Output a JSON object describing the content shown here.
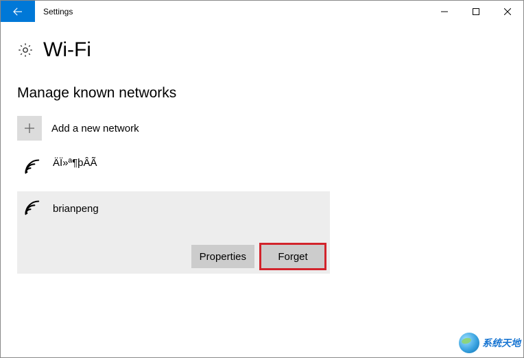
{
  "window": {
    "title": "Settings"
  },
  "page": {
    "title": "Wi-Fi",
    "section_heading": "Manage known networks"
  },
  "add": {
    "label": "Add a new network"
  },
  "networks": [
    {
      "name": "ÄÏ»ª¶þÂÃ",
      "selected": false
    },
    {
      "name": "brianpeng",
      "selected": true
    }
  ],
  "actions": {
    "properties": "Properties",
    "forget": "Forget"
  },
  "watermark": {
    "text": "系统天地"
  }
}
